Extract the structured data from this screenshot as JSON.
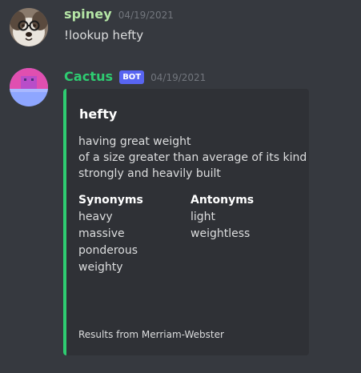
{
  "messages": [
    {
      "username": "spiney",
      "timestamp": "04/19/2021",
      "content": "!lookup hefty"
    },
    {
      "username": "Cactus",
      "badge": "BOT",
      "timestamp": "04/19/2021",
      "embed": {
        "title": "hefty",
        "description": [
          "having great weight",
          "of a size greater than average of its kind",
          "strongly and heavily built"
        ],
        "fields": [
          {
            "title": "Synonyms",
            "items": [
              "heavy",
              "massive",
              "ponderous",
              "weighty"
            ]
          },
          {
            "title": "Antonyms",
            "items": [
              "light",
              "weightless"
            ]
          }
        ],
        "footer": "Results from Merriam-Webster"
      }
    }
  ],
  "colors": {
    "background": "#36393f",
    "embed_background": "#2f3136",
    "embed_accent": "#2ecc71",
    "bot_badge": "#5865f2",
    "username_spiney": "#b5e6a6",
    "username_cactus": "#2ecc71"
  }
}
